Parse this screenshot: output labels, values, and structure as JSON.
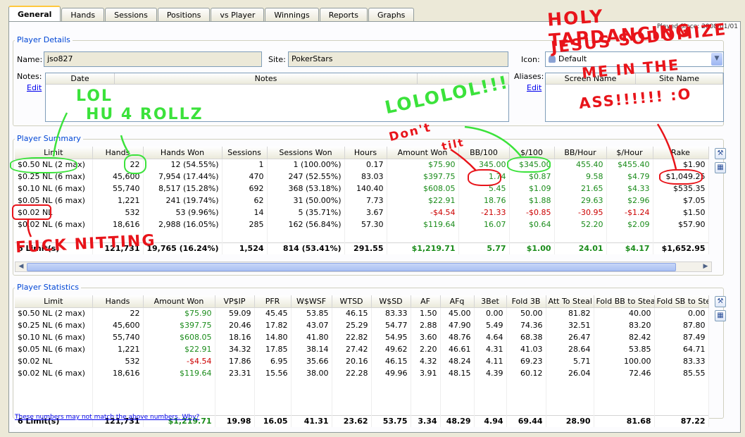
{
  "tabs": [
    "General",
    "Hands",
    "Sessions",
    "Positions",
    "vs Player",
    "Winnings",
    "Reports",
    "Graphs"
  ],
  "played_since": "Played Since: 2008/01/01",
  "player_details": {
    "title": "Player Details",
    "name_label": "Name:",
    "name_value": "jso827",
    "site_label": "Site:",
    "site_value": "PokerStars",
    "icon_label": "Icon:",
    "icon_value": "Default",
    "notes_label": "Notes:",
    "notes_edit": "Edit",
    "notes_cols": [
      "Date",
      "Notes"
    ],
    "aliases_label": "Aliases:",
    "aliases_edit": "Edit",
    "aliases_cols": [
      "Screen Name",
      "Site Name"
    ]
  },
  "summary": {
    "title": "Player Summary",
    "headers": [
      "Limit",
      "Hands",
      "Hands Won",
      "Sessions",
      "Sessions Won",
      "Hours",
      "Amount Won",
      "BB/100",
      "$/100",
      "BB/Hour",
      "$/Hour",
      "Rake"
    ],
    "rows": [
      [
        "$0.50 NL (2 max)",
        "22",
        "12 (54.55%)",
        "1",
        "1 (100.00%)",
        "0.17",
        "$75.90",
        "345.00",
        "$345.00",
        "455.40",
        "$455.40",
        "$1.90"
      ],
      [
        "$0.25 NL (6 max)",
        "45,600",
        "7,954 (17.44%)",
        "470",
        "247 (52.55%)",
        "83.03",
        "$397.75",
        "1.74",
        "$0.87",
        "9.58",
        "$4.79",
        "$1,049.25"
      ],
      [
        "$0.10 NL (6 max)",
        "55,740",
        "8,517 (15.28%)",
        "692",
        "368 (53.18%)",
        "140.40",
        "$608.05",
        "5.45",
        "$1.09",
        "21.65",
        "$4.33",
        "$535.35"
      ],
      [
        "$0.05 NL (6 max)",
        "1,221",
        "241 (19.74%)",
        "62",
        "31 (50.00%)",
        "7.73",
        "$22.91",
        "18.76",
        "$1.88",
        "29.63",
        "$2.96",
        "$7.05"
      ],
      [
        "$0.02 NL",
        "532",
        "53 (9.96%)",
        "14",
        "5 (35.71%)",
        "3.67",
        "-$4.54",
        "-21.33",
        "-$0.85",
        "-30.95",
        "-$1.24",
        "$1.50"
      ],
      [
        "$0.02 NL (6 max)",
        "18,616",
        "2,988 (16.05%)",
        "285",
        "162 (56.84%)",
        "57.30",
        "$119.64",
        "16.07",
        "$0.64",
        "52.20",
        "$2.09",
        "$57.90"
      ]
    ],
    "total": [
      "6 Limit(s)",
      "121,731",
      "19,765 (16.24%)",
      "1,524",
      "814 (53.41%)",
      "291.55",
      "$1,219.71",
      "5.77",
      "$1.00",
      "24.01",
      "$4.17",
      "$1,652.95"
    ]
  },
  "statistics": {
    "title": "Player Statistics",
    "headers": [
      "Limit",
      "Hands",
      "Amount Won",
      "VP$IP",
      "PFR",
      "W$WSF",
      "WTSD",
      "W$SD",
      "AF",
      "AFq",
      "3Bet",
      "Fold 3B",
      "Att To Steal",
      "Fold BB to Steal",
      "Fold SB to Steal"
    ],
    "rows": [
      [
        "$0.50 NL (2 max)",
        "22",
        "$75.90",
        "59.09",
        "45.45",
        "53.85",
        "46.15",
        "83.33",
        "1.50",
        "45.00",
        "0.00",
        "50.00",
        "81.82",
        "40.00",
        "0.00"
      ],
      [
        "$0.25 NL (6 max)",
        "45,600",
        "$397.75",
        "20.46",
        "17.82",
        "43.07",
        "25.29",
        "54.77",
        "2.88",
        "47.90",
        "5.49",
        "74.36",
        "32.51",
        "83.20",
        "87.80"
      ],
      [
        "$0.10 NL (6 max)",
        "55,740",
        "$608.05",
        "18.16",
        "14.80",
        "41.80",
        "22.82",
        "54.95",
        "3.60",
        "48.76",
        "4.64",
        "68.38",
        "26.47",
        "82.42",
        "87.49"
      ],
      [
        "$0.05 NL (6 max)",
        "1,221",
        "$22.91",
        "34.32",
        "17.85",
        "38.14",
        "27.42",
        "49.62",
        "2.20",
        "46.61",
        "4.31",
        "41.03",
        "28.64",
        "53.85",
        "64.71"
      ],
      [
        "$0.02 NL",
        "532",
        "-$4.54",
        "17.86",
        "6.95",
        "35.66",
        "20.16",
        "46.15",
        "4.32",
        "48.24",
        "4.11",
        "69.23",
        "5.71",
        "100.00",
        "83.33"
      ],
      [
        "$0.02 NL (6 max)",
        "18,616",
        "$119.64",
        "23.31",
        "15.56",
        "38.00",
        "22.28",
        "49.96",
        "3.91",
        "48.15",
        "4.39",
        "60.12",
        "26.04",
        "72.46",
        "85.55"
      ]
    ],
    "total": [
      "6 Limit(s)",
      "121,731",
      "$1,219.71",
      "19.98",
      "16.05",
      "41.31",
      "23.62",
      "53.75",
      "3.34",
      "48.29",
      "4.94",
      "69.44",
      "28.90",
      "81.68",
      "87.22"
    ],
    "footnote": "These numbers may not match the above numbers.  Why?"
  },
  "annotations": {
    "holy": "HOLY TAPDANCING",
    "jesus": "JESUS SODOMIZE",
    "me": "ME IN THE",
    "ass": "ASS!!!!!! :O",
    "lol": "LOL",
    "hu": "HU 4 ROLLZ",
    "lololol": "LOLOLOL!!!",
    "dont": "Don't",
    "tilt": "tilt",
    "fuck": "FUCK NITTING"
  }
}
